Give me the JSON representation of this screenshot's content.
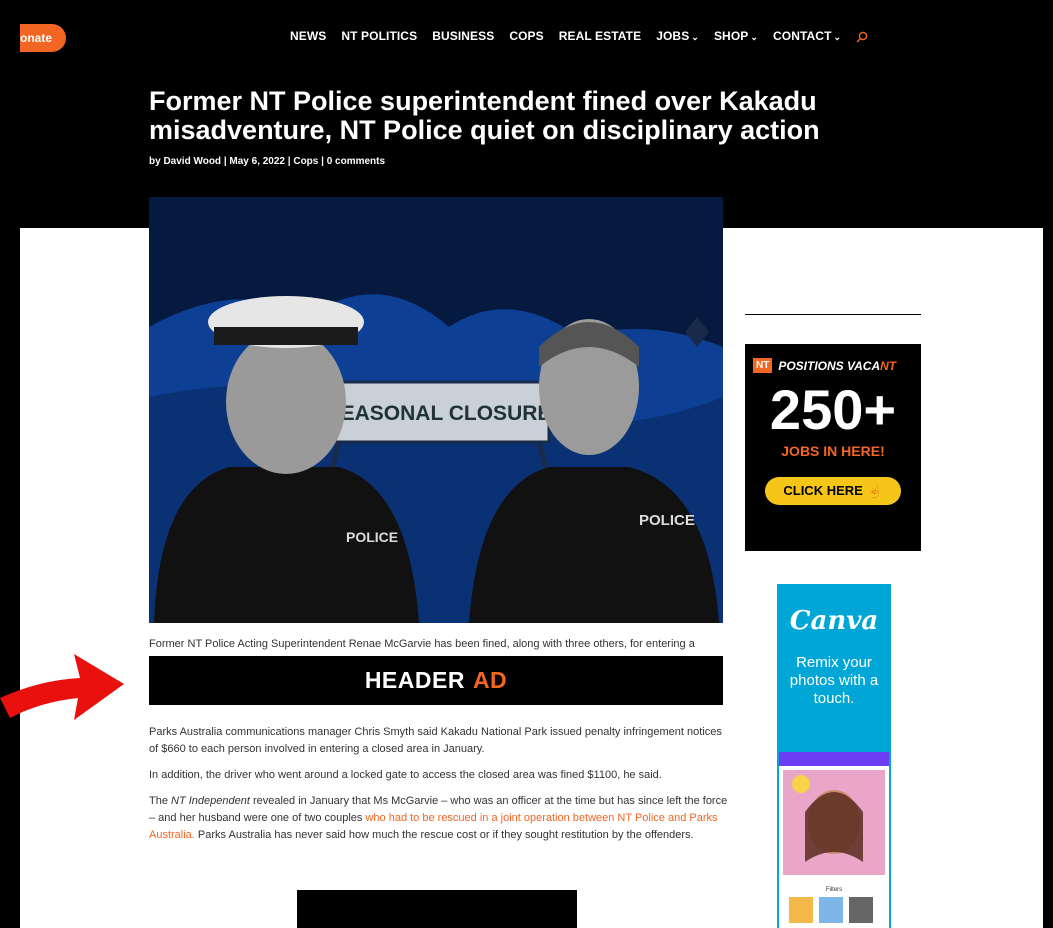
{
  "donate": {
    "label": "onate"
  },
  "nav": {
    "items": [
      {
        "label": "NEWS",
        "caret": false
      },
      {
        "label": "NT POLITICS",
        "caret": false
      },
      {
        "label": "BUSINESS",
        "caret": false
      },
      {
        "label": "COPS",
        "caret": false
      },
      {
        "label": "REAL ESTATE",
        "caret": false
      },
      {
        "label": "JOBS",
        "caret": true
      },
      {
        "label": "SHOP",
        "caret": true
      },
      {
        "label": "CONTACT",
        "caret": true
      }
    ],
    "search_icon": "search-icon"
  },
  "article": {
    "title": "Former NT Police superintendent fined over Kakadu misadventure, NT Police quiet on disciplinary action",
    "meta": "by David Wood | May 6, 2022 | Cops | 0 comments",
    "sign_text": "SEASONAL CLOSURE",
    "police_left": "POLICE",
    "police_right": "POLICE",
    "caption": "Former NT Police Acting Superintendent Renae McGarvie has been fined, along with three others, for entering a",
    "paragraphs": {
      "p1": "Parks Australia communications manager Chris Smyth said Kakadu National Park issued penalty infringement notices of $660 to each person involved in entering a closed area in January.",
      "p2": "In addition, the driver who went around a locked gate to access the closed area was fined $1100, he said.",
      "p3_a": "The ",
      "p3_em": "NT Independent",
      "p3_b": " revealed in January that Ms McGarvie – who was an officer at the time but has since left the force – and her husband were one of two couples ",
      "p3_link": "who had to be rescued in a joint operation between NT Police and Parks Australia.",
      "p3_c": " Parks Australia has never said how much the rescue cost or if they sought restitution by the offenders."
    }
  },
  "header_ad": {
    "word1": "HEADER",
    "word2": "AD"
  },
  "jobs_ad": {
    "logo": "NT",
    "head1": "POSITIONS VACA",
    "head2": "NT",
    "number": "250+",
    "sub": "JOBS IN HERE!",
    "button": "CLICK HERE"
  },
  "canva_ad": {
    "brand": "Canva",
    "tagline": "Remix your photos with a touch.",
    "filters_label": "Filters"
  },
  "colors": {
    "accent": "#f26522",
    "arrow": "#e8110e",
    "canva": "#00a6d6"
  }
}
